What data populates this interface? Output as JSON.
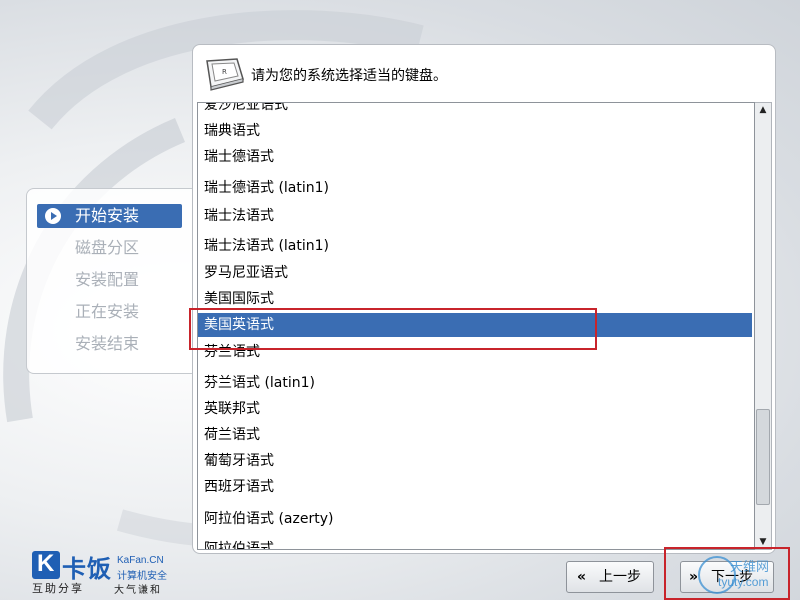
{
  "header": {
    "text": "请为您的系统选择适当的键盘。",
    "icon": "keyboard-key-icon"
  },
  "steps": [
    {
      "label": "开始安装",
      "active": true
    },
    {
      "label": "磁盘分区",
      "active": false
    },
    {
      "label": "安装配置",
      "active": false
    },
    {
      "label": "正在安装",
      "active": false
    },
    {
      "label": "安装结束",
      "active": false
    }
  ],
  "keyboard_list": {
    "items": [
      "爱沙尼亚语式",
      "瑞典语式",
      "瑞士德语式",
      "瑞士德语式 (latin1)",
      "瑞士法语式",
      "瑞士法语式 (latin1)",
      "罗马尼亚语式",
      "美国国际式",
      "美国英语式",
      "芬兰语式",
      "芬兰语式 (latin1)",
      "英联邦式",
      "荷兰语式",
      "葡萄牙语式",
      "西班牙语式",
      "阿拉伯语式 (azerty)",
      "阿拉伯语式"
    ],
    "selected": "美国英语式"
  },
  "buttons": {
    "back_glyph": "«",
    "back_label": "上一步",
    "next_glyph": "»",
    "next_label": "下一步"
  },
  "branding": {
    "logo_k": "K",
    "logo_main": "卡饭",
    "logo_en": "KaFan.CN",
    "logo_sub": "计算机安全",
    "slogan": "互助分享",
    "slogan2": "大气谦和"
  },
  "watermark": {
    "cn": "天维网",
    "en": "tyuty.com"
  },
  "colors": {
    "selection": "#3a6db3",
    "highlight_box": "#c8242b",
    "brand": "#1f5fb4"
  }
}
